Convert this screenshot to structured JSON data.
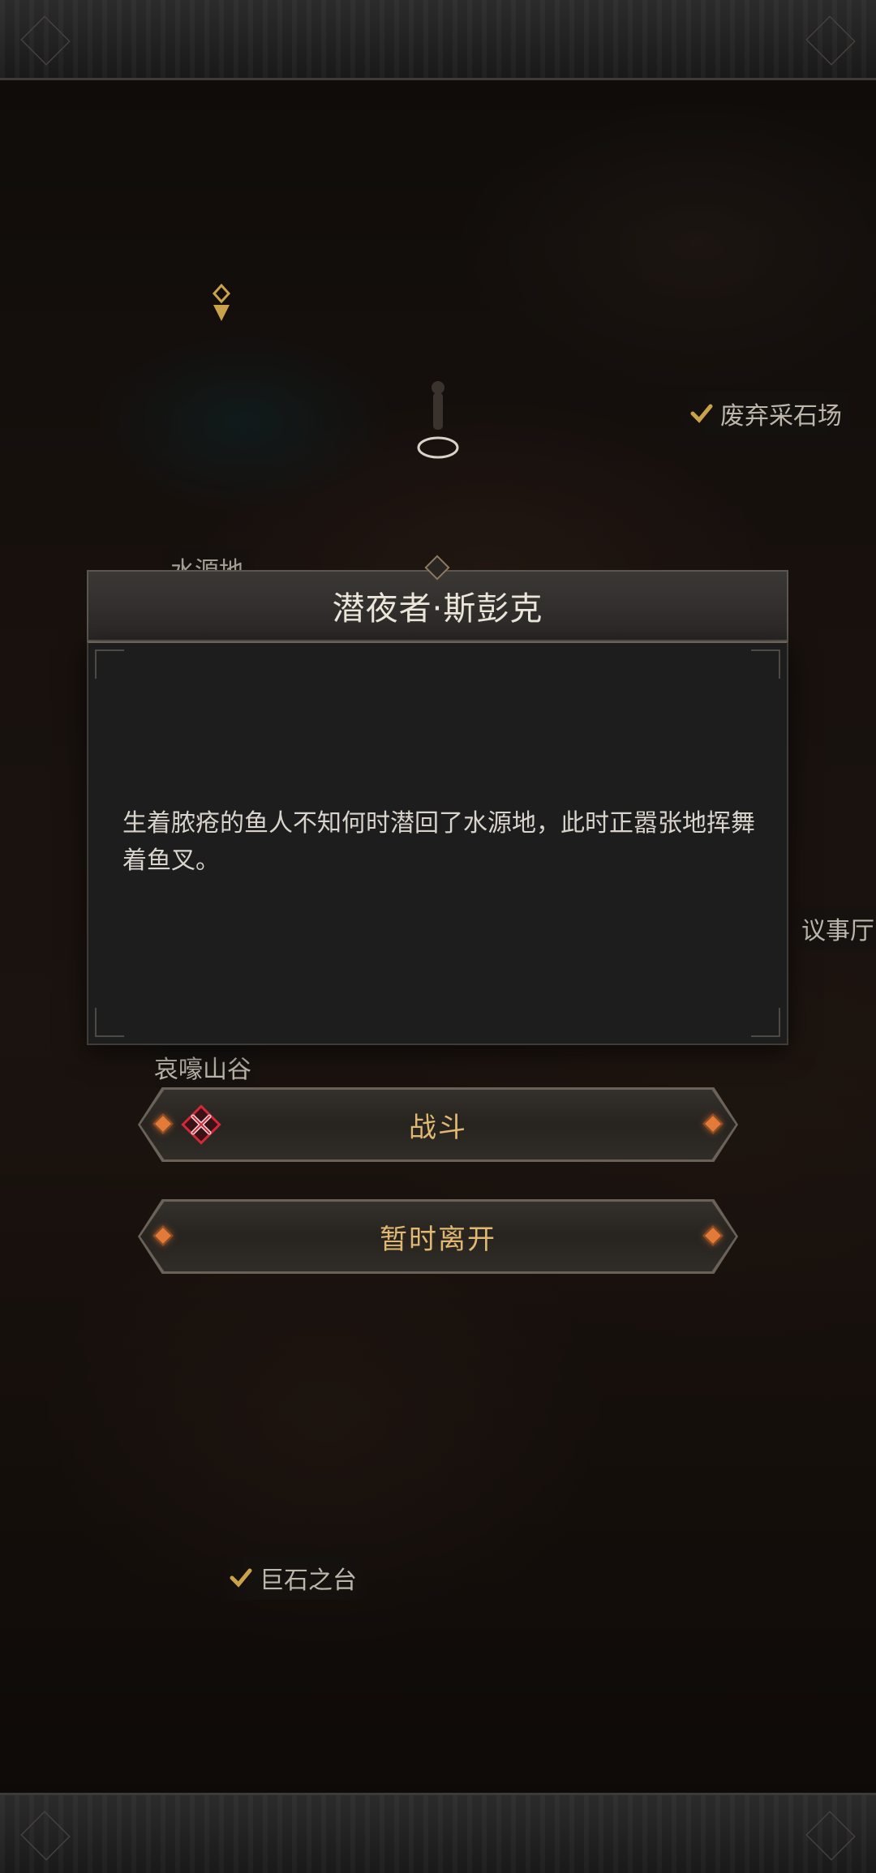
{
  "map_labels": {
    "abandoned_quarry": "废弃采石场",
    "water_source_partial": "水源地",
    "council_hall": "议事厅",
    "wailing_valley": "哀嚎山谷",
    "boulder_platform": "巨石之台"
  },
  "dialog": {
    "title": "潜夜者·斯彭克",
    "description": "生着脓疮的鱼人不知何时潜回了水源地，此时正嚣张地挥舞着鱼叉。"
  },
  "actions": {
    "fight_label": "战斗",
    "leave_label": "暂时离开"
  },
  "colors": {
    "button_text": "#e0b871",
    "gem": "#e27a3a",
    "battle_icon": "#d2283a",
    "check": "#c9a24a"
  },
  "icons": {
    "fight": "crossed-swords-icon",
    "visited": "check-icon",
    "map_marker": "map-marker-icon"
  }
}
